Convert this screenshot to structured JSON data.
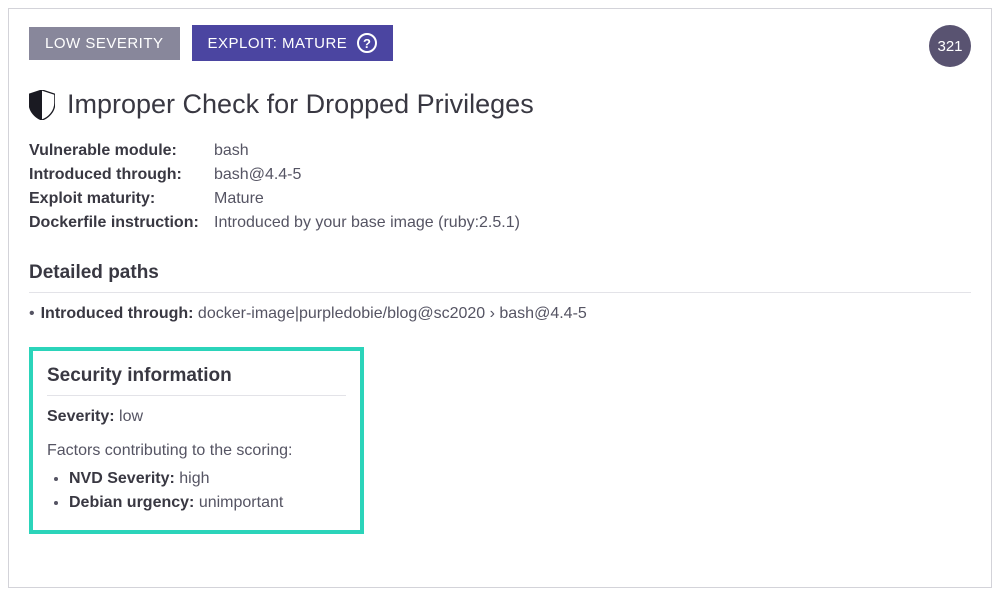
{
  "badges": {
    "severity": "LOW SEVERITY",
    "exploit": "EXPLOIT: MATURE"
  },
  "count": "321",
  "title": "Improper Check for Dropped Privileges",
  "details": {
    "vulnerable_module_label": "Vulnerable module:",
    "vulnerable_module_value": "bash",
    "introduced_through_label": "Introduced through:",
    "introduced_through_value": "bash@4.4-5",
    "exploit_maturity_label": "Exploit maturity:",
    "exploit_maturity_value": "Mature",
    "dockerfile_label": "Dockerfile instruction:",
    "dockerfile_value": "Introduced by your base image (ruby:2.5.1)"
  },
  "paths": {
    "heading": "Detailed paths",
    "introduced_label": "Introduced through:",
    "introduced_value": "docker-image|purpledobie/blog@sc2020 › bash@4.4-5"
  },
  "security": {
    "heading": "Security information",
    "severity_label": "Severity:",
    "severity_value": "low",
    "factors_intro": "Factors contributing to the scoring:",
    "nvd_label": "NVD Severity:",
    "nvd_value": "high",
    "debian_label": "Debian urgency:",
    "debian_value": "unimportant"
  }
}
